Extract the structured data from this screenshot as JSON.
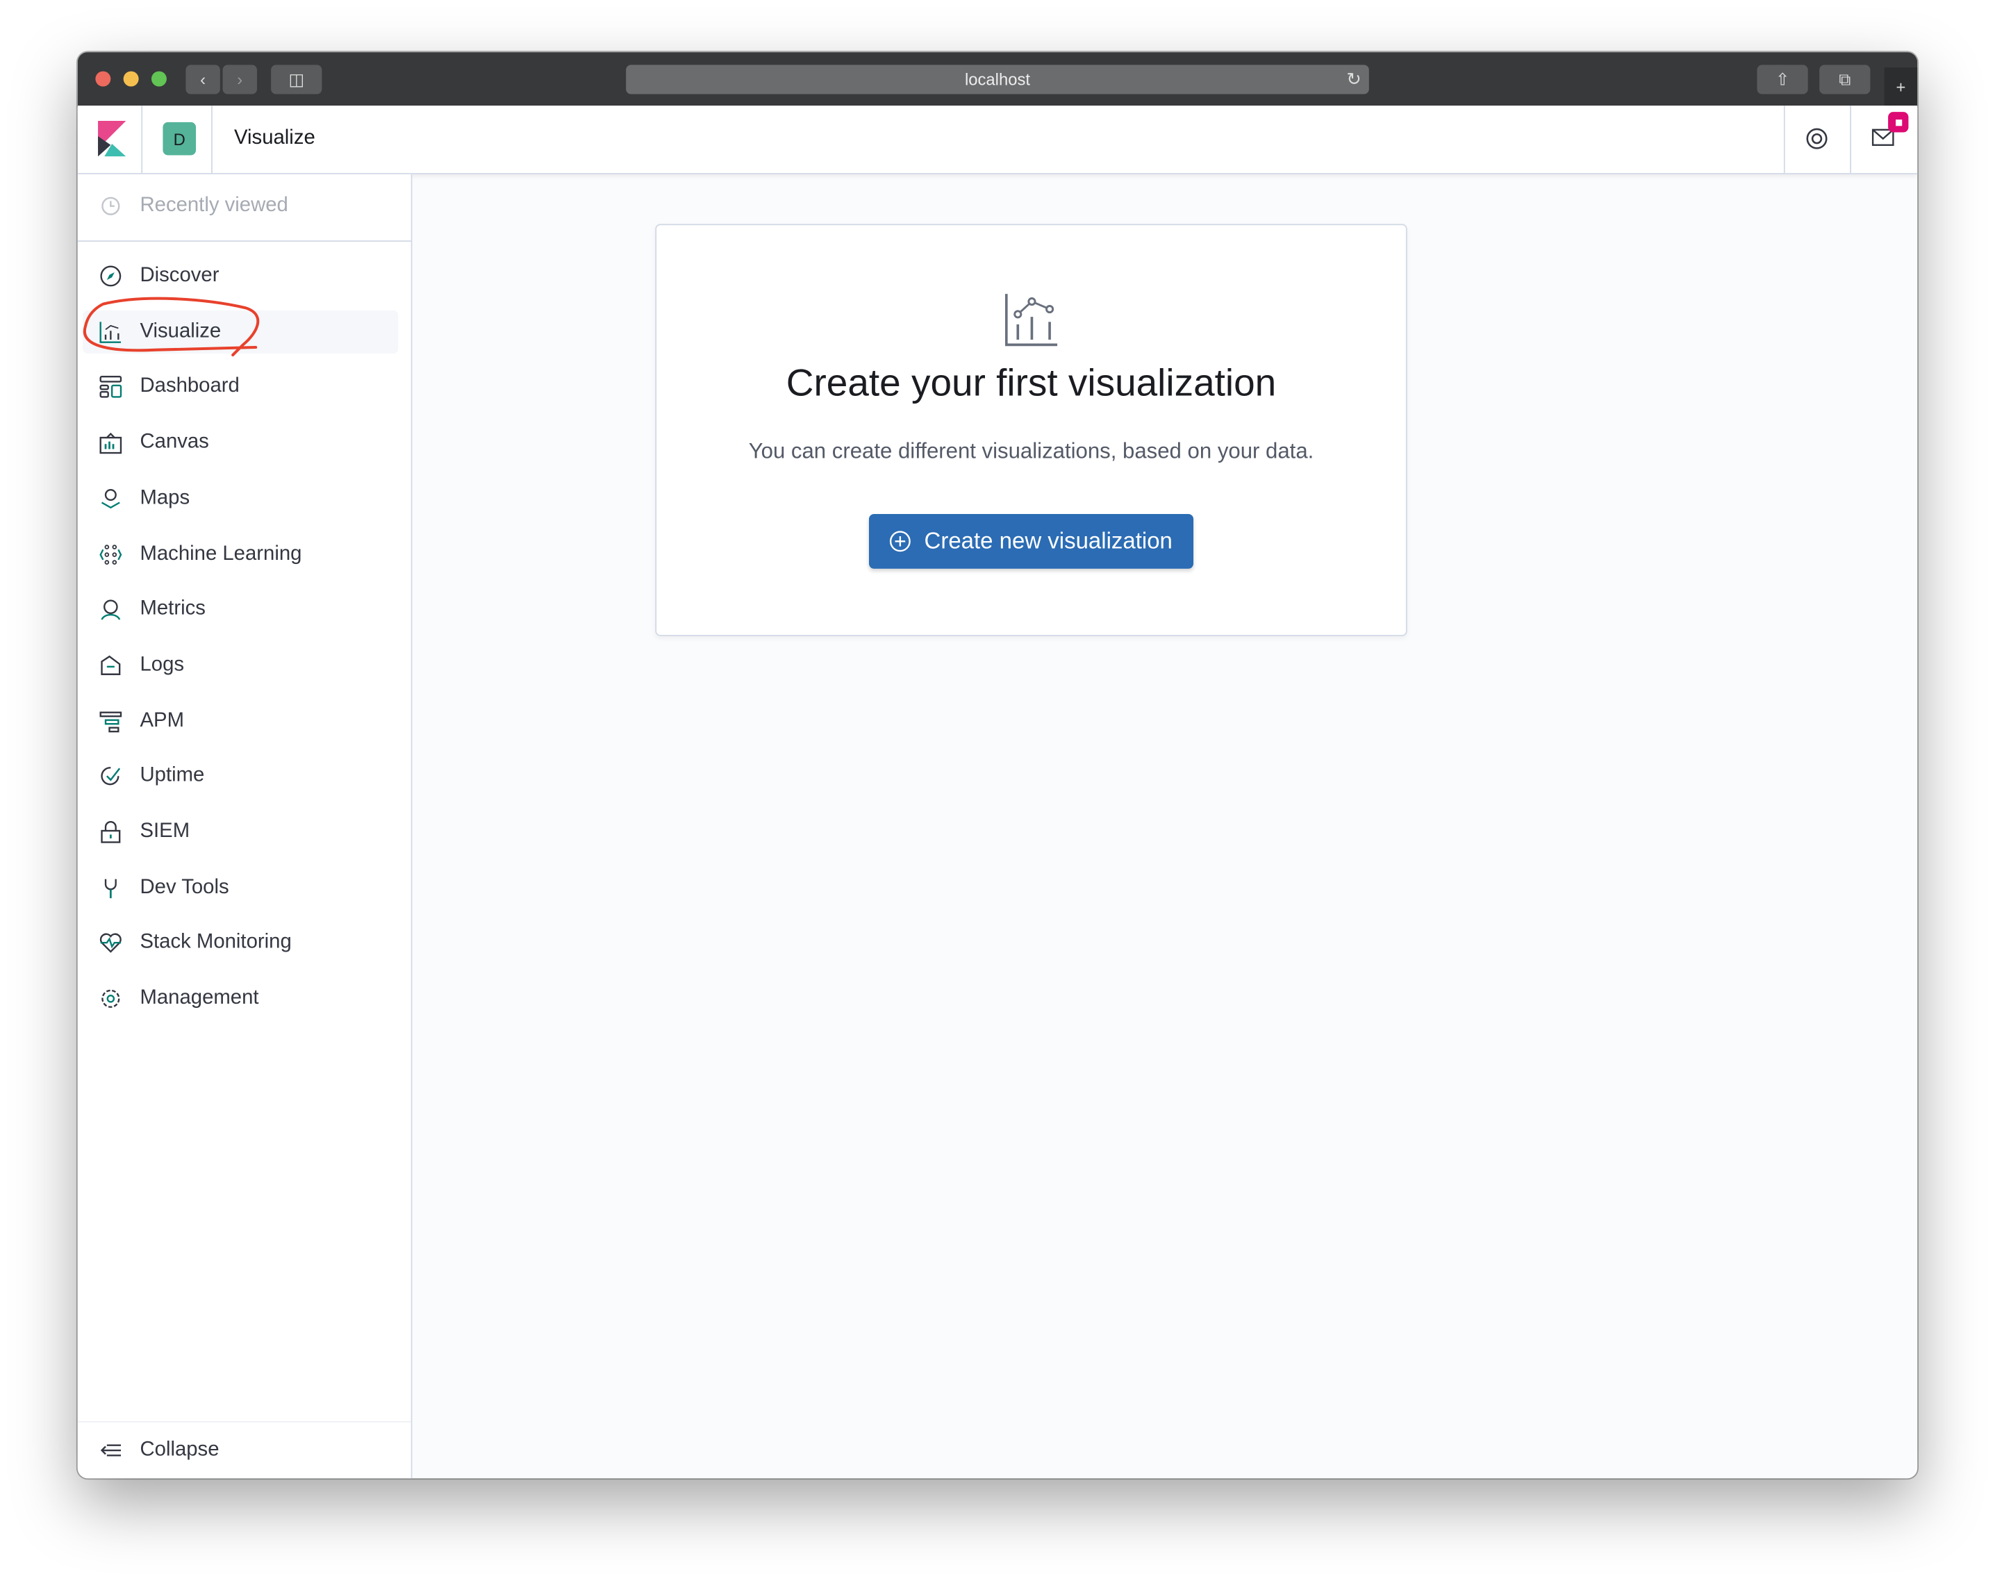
{
  "browser": {
    "url": "localhost"
  },
  "header": {
    "space_initial": "D",
    "app_title": "Visualize",
    "space_color": "#54b399",
    "notification_color": "#dd0a73"
  },
  "sidebar": {
    "recently_viewed": "Recently viewed",
    "items": [
      {
        "label": "Discover",
        "icon": "compass-icon"
      },
      {
        "label": "Visualize",
        "icon": "visualize-icon",
        "active": true
      },
      {
        "label": "Dashboard",
        "icon": "dashboard-icon"
      },
      {
        "label": "Canvas",
        "icon": "canvas-icon"
      },
      {
        "label": "Maps",
        "icon": "maps-icon"
      },
      {
        "label": "Machine Learning",
        "icon": "machine-learning-icon"
      },
      {
        "label": "Metrics",
        "icon": "metrics-icon"
      },
      {
        "label": "Logs",
        "icon": "logs-icon"
      },
      {
        "label": "APM",
        "icon": "apm-icon"
      },
      {
        "label": "Uptime",
        "icon": "uptime-icon"
      },
      {
        "label": "SIEM",
        "icon": "siem-icon"
      },
      {
        "label": "Dev Tools",
        "icon": "dev-tools-icon"
      },
      {
        "label": "Stack Monitoring",
        "icon": "stack-monitoring-icon"
      },
      {
        "label": "Management",
        "icon": "gear-icon"
      }
    ],
    "collapse": "Collapse"
  },
  "main": {
    "title": "Create your first visualization",
    "subtitle": "You can create different visualizations, based on your data.",
    "button": "Create new visualization",
    "accent": "#2b6cb4"
  },
  "annotation": {
    "color": "#e8412c"
  }
}
